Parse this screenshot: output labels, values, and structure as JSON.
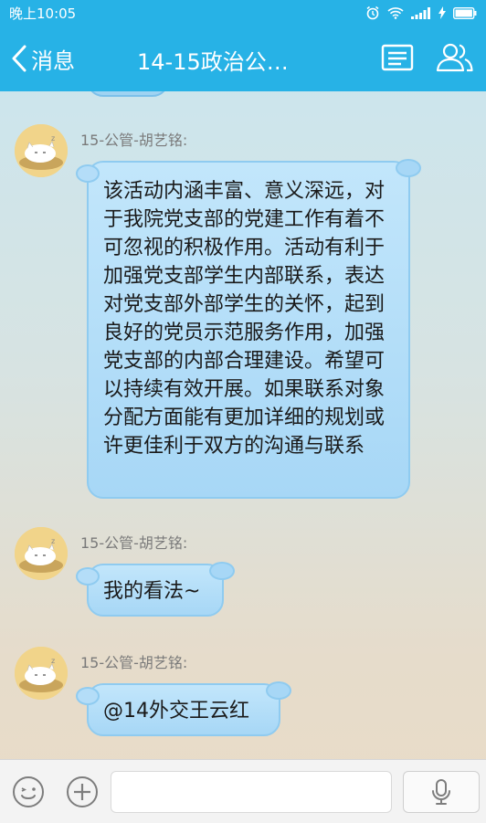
{
  "status_bar": {
    "time": "晚上10:05"
  },
  "nav": {
    "back_label": "消息",
    "title": "14-15政治公…"
  },
  "messages": [
    {
      "sender": "15-公管-胡艺铭:",
      "text": "该活动内涵丰富、意义深远，对于我院党支部的党建工作有着不可忽视的积极作用。活动有利于加强党支部学生内部联系，表达对党支部外部学生的关怀，起到良好的党员示范服务作用，加强党支部的内部合理建设。希望可以持续有效开展。如果联系对象分配方面能有更加详细的规划或许更佳利于双方的沟通与联系"
    },
    {
      "sender": "15-公管-胡艺铭:",
      "text": "我的看法~"
    },
    {
      "sender": "15-公管-胡艺铭:",
      "text": "@14外交王云红"
    }
  ],
  "input": {
    "value": "",
    "placeholder": ""
  },
  "icons": {
    "alarm": "alarm-icon",
    "wifi": "wifi-icon",
    "signal": "signal-icon",
    "battery": "battery-icon",
    "group_info": "group-info-icon",
    "members": "members-icon",
    "emoji": "emoji-icon",
    "plus": "plus-icon",
    "mic": "mic-icon"
  },
  "colors": {
    "header": "#27b2e6",
    "bubble": "#a7d7f6",
    "bubble_border": "#8fcbf0"
  }
}
